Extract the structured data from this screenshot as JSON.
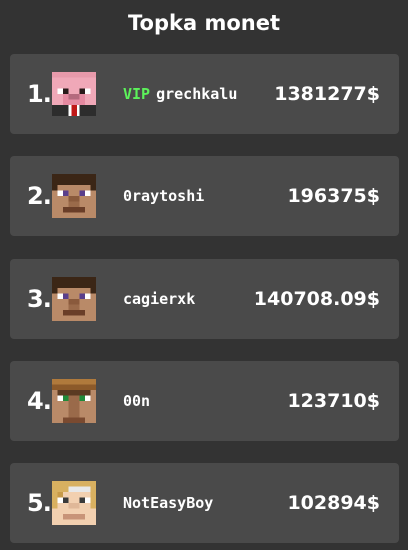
{
  "title": "Topka monet",
  "players": [
    {
      "rank": "1.",
      "tag": "VIP",
      "name": "grechkalu",
      "money": "1381277$",
      "avatar": "pig-skin-icon"
    },
    {
      "rank": "2.",
      "tag": "",
      "name": "0raytoshi",
      "money": "196375$",
      "avatar": "steve-skin-icon"
    },
    {
      "rank": "3.",
      "tag": "",
      "name": "cagierxk",
      "money": "140708.09$",
      "avatar": "steve-skin-icon"
    },
    {
      "rank": "4.",
      "tag": "",
      "name": "00n",
      "money": "123710$",
      "avatar": "villager-skin-icon"
    },
    {
      "rank": "5.",
      "tag": "",
      "name": "NotEasyBoy",
      "money": "102894$",
      "avatar": "blonde-skin-icon"
    }
  ],
  "colors": {
    "background": "#333333",
    "card": "#4a4a4a",
    "text": "#ffffff",
    "vip": "#5cf25a"
  }
}
